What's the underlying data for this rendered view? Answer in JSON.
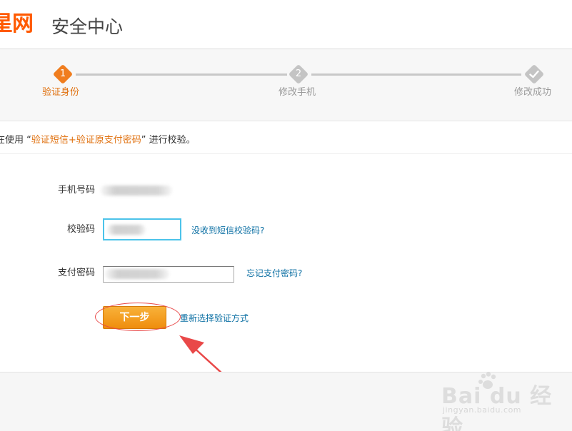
{
  "header": {
    "logo_text": "星网",
    "title": "安全中心"
  },
  "steps": [
    {
      "number": "1",
      "label": "验证身份",
      "state": "active"
    },
    {
      "number": "2",
      "label": "修改手机",
      "state": "pending"
    },
    {
      "number": "",
      "label": "修改成功",
      "state": "pending"
    }
  ],
  "info": {
    "prefix": "在使用 “",
    "method": "验证短信+验证原支付密码",
    "suffix": "” 进行校验。"
  },
  "form": {
    "phone_label": "手机号码",
    "code_label": "校验码",
    "code_link": "没收到短信校验码?",
    "pay_label": "支付密码",
    "pay_link": "忘记支付密码?",
    "next_button": "下一步",
    "reselect_link": "重新选择验证方式"
  },
  "watermark": {
    "logo": "Bai du 经验",
    "sub": "jingyan.baidu.com"
  },
  "colors": {
    "accent": "#f07d1e",
    "link": "#0b6fa3",
    "step_inactive": "#c4c4c4",
    "annotation": "#e94848"
  }
}
